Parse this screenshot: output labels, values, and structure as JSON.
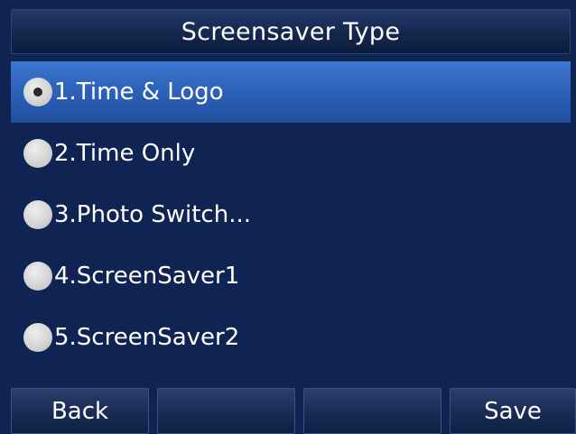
{
  "title": "Screensaver Type",
  "options": [
    {
      "label": "1.Time & Logo",
      "selected": true
    },
    {
      "label": "2.Time Only",
      "selected": false
    },
    {
      "label": "3.Photo Switch...",
      "selected": false
    },
    {
      "label": "4.ScreenSaver1",
      "selected": false
    },
    {
      "label": "5.ScreenSaver2",
      "selected": false
    }
  ],
  "softkeys": [
    "Back",
    "",
    "",
    "Save"
  ],
  "colors": {
    "background": "#0f2452",
    "highlight": "#2b5fb5",
    "text": "#ffffff",
    "radio": "#d2d2d2"
  }
}
